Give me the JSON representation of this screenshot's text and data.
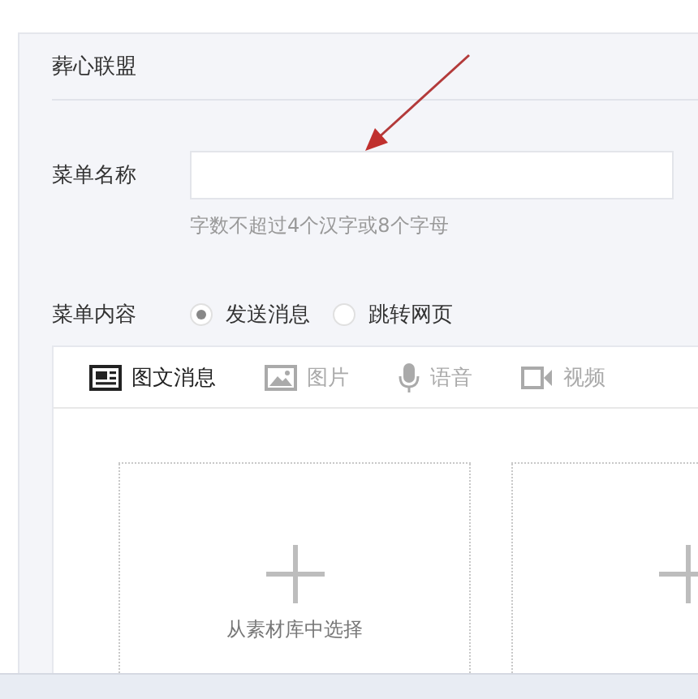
{
  "menu_name": "葬心联盟",
  "name_field": {
    "label": "菜单名称",
    "hint": "字数不超过4个汉字或8个字母"
  },
  "content": {
    "label": "菜单内容",
    "options": [
      {
        "label": "发送消息",
        "selected": true
      },
      {
        "label": "跳转网页",
        "selected": false
      }
    ]
  },
  "tabs": [
    {
      "label": "图文消息",
      "kind": "article",
      "selected": true
    },
    {
      "label": "图片",
      "kind": "image",
      "selected": false
    },
    {
      "label": "语音",
      "kind": "voice",
      "selected": false
    },
    {
      "label": "视频",
      "kind": "video",
      "selected": false
    }
  ],
  "cards": [
    {
      "kind": "add",
      "label": "从素材库中选择"
    },
    {
      "kind": "add"
    }
  ]
}
